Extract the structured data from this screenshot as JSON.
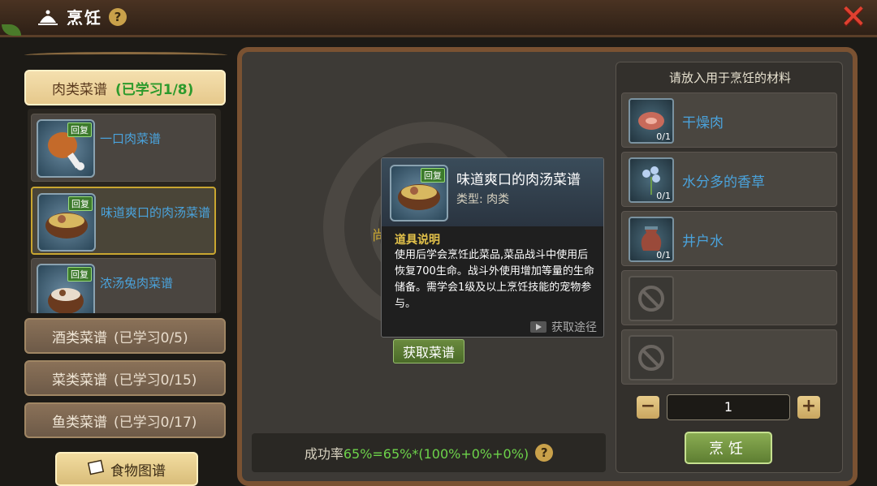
{
  "header": {
    "title": "烹饪",
    "help_icon": "?"
  },
  "categories": [
    {
      "label": "肉类菜谱",
      "progress": "(已学习1/8)"
    },
    {
      "label": "酒类菜谱",
      "progress": "(已学习0/5)"
    },
    {
      "label": "菜类菜谱",
      "progress": "(已学习0/15)"
    },
    {
      "label": "鱼类菜谱",
      "progress": "(已学习0/17)"
    }
  ],
  "recipes": [
    {
      "name": "一口肉菜谱",
      "tag": "回复"
    },
    {
      "name": "味道爽口的肉汤菜谱",
      "tag": "回复"
    },
    {
      "name": "浓汤兔肉菜谱",
      "tag": "回复"
    }
  ],
  "atlas_button": "食物图谱",
  "center": {
    "ghost_text": "尚 菜谱",
    "get_recipe_button": "获取菜谱",
    "success_label": "成功率",
    "success_value": "65%=65%*(100%+0%+0%)",
    "help_icon": "?"
  },
  "tooltip": {
    "tag": "回复",
    "name": "味道爽口的肉汤菜谱",
    "type": "类型: 肉类",
    "desc_title": "道具说明",
    "desc": "使用后学会烹饪此菜品,菜品战斗中使用后恢复700生命。战斗外使用增加等量的生命储备。需学会1级及以上烹饪技能的宠物参与。",
    "source": "获取途径"
  },
  "materials": {
    "title": "请放入用于烹饪的材料",
    "slots": [
      {
        "name": "干燥肉",
        "count": "0/1"
      },
      {
        "name": "水分多的香草",
        "count": "0/1"
      },
      {
        "name": "井户水",
        "count": "0/1"
      },
      {
        "name": "",
        "count": ""
      },
      {
        "name": "",
        "count": ""
      }
    ]
  },
  "quantity": {
    "minus": "−",
    "value": "1",
    "plus": "+"
  },
  "cook_button": "烹饪"
}
